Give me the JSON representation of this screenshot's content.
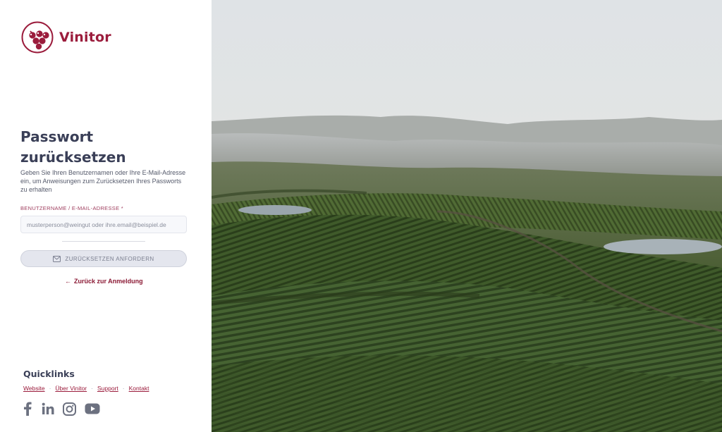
{
  "brand": {
    "name": "Vinitor",
    "logo_icon": "grapes-icon",
    "color": "#9b1c3c"
  },
  "form": {
    "title": "Passwort zurücksetzen",
    "description": "Geben Sie Ihren Benutzernamen oder Ihre E-Mail-Adresse ein, um Anweisungen zum Zurücksetzen Ihres Passworts zu erhalten",
    "field_label": "BENUTZERNAME / E-MAIL-ADRESSE *",
    "field_placeholder": "musterperson@weingut oder ihre.email@beispiel.de",
    "field_value": "",
    "submit_label": "ZURÜCKSETZEN ANFORDERN",
    "submit_icon": "mail-icon",
    "back_arrow": "←",
    "back_label": "Zurück zur Anmeldung"
  },
  "quicklinks": {
    "title": "Quicklinks",
    "links": [
      "Website",
      "Über Vinitor",
      "Support",
      "Kontakt"
    ],
    "separator": "·",
    "social_icons": [
      "facebook-icon",
      "linkedin-icon",
      "instagram-icon",
      "youtube-icon"
    ]
  },
  "hero": {
    "image": "vineyard-aerial-photo"
  }
}
